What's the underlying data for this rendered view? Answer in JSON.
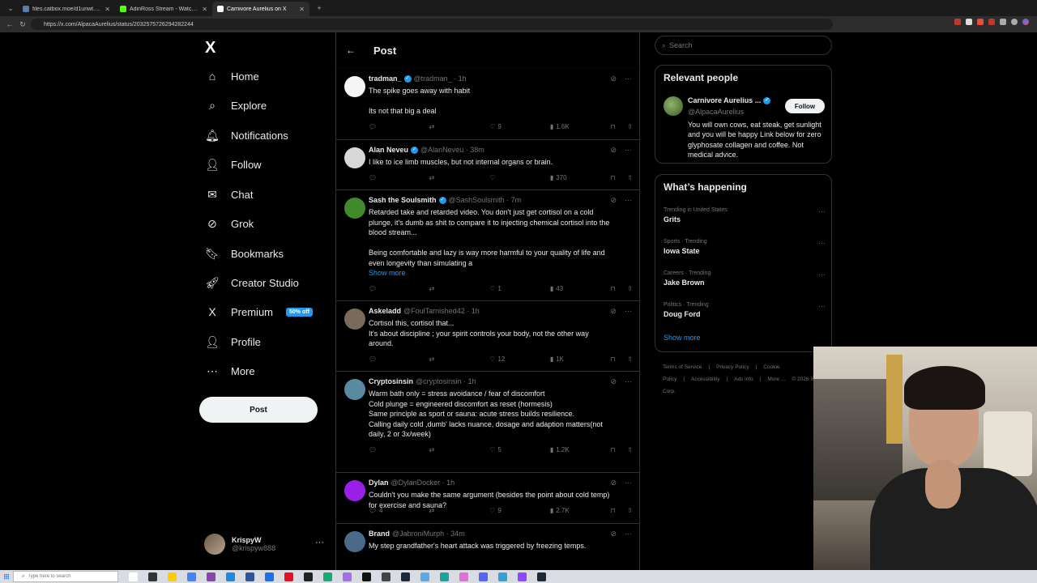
{
  "browser": {
    "tabs": [
      {
        "label": "files.catbox.moe/d1unwt.mp4",
        "color": "#5b7fa8",
        "active": false
      },
      {
        "label": "AdinRoss Stream - Watch Live on Kick",
        "color": "#53fc18",
        "active": false
      },
      {
        "label": "Carnivore Aurelius on X",
        "color": "#ffffff",
        "active": true
      }
    ],
    "url": "https://x.com/AlpacaAurelius/status/2032575726294282244"
  },
  "sidebar": {
    "logo": "X",
    "items": [
      {
        "label": "Home",
        "icon": "home-icon",
        "glyph": "⌂"
      },
      {
        "label": "Explore",
        "icon": "search-icon",
        "glyph": "⌕"
      },
      {
        "label": "Notifications",
        "icon": "bell-icon",
        "glyph": "🔔︎"
      },
      {
        "label": "Follow",
        "icon": "person-plus-icon",
        "glyph": "👤︎"
      },
      {
        "label": "Chat",
        "icon": "mail-icon",
        "glyph": "✉"
      },
      {
        "label": "Grok",
        "icon": "grok-icon",
        "glyph": "⊘"
      },
      {
        "label": "Bookmarks",
        "icon": "bookmark-icon",
        "glyph": "🔖︎"
      },
      {
        "label": "Creator Studio",
        "icon": "rocket-icon",
        "glyph": "🚀︎"
      },
      {
        "label": "Premium",
        "icon": "x-icon",
        "glyph": "X",
        "badge": "50% off"
      },
      {
        "label": "Profile",
        "icon": "profile-icon",
        "glyph": "👤︎"
      },
      {
        "label": "More",
        "icon": "more-circle-icon",
        "glyph": "⋯"
      }
    ],
    "post_label": "Post",
    "account": {
      "name": "KrispyW",
      "handle": "@krispyw888"
    }
  },
  "header": {
    "title": "Post"
  },
  "tweets": [
    {
      "name": "tradman_",
      "handle": "@tradman_ · 1h",
      "verified": true,
      "avatar_color": "#f5f5f5",
      "lines": [
        "The spike goes away with habit",
        "",
        "Its not that big a deal"
      ],
      "replies": "",
      "retweets": "",
      "likes": "9",
      "views": "1.6K"
    },
    {
      "name": "Alan Neveu",
      "handle": "@AlanNeveu · 38m",
      "verified": true,
      "avatar_color": "#d8d8d8",
      "lines": [
        "I like to ice limb muscles, but not internal organs or brain."
      ],
      "replies": "",
      "retweets": "",
      "likes": "",
      "views": "370"
    },
    {
      "name": "Sash the Soulsmith",
      "handle": "@SashSoulsmith · 7m",
      "verified": true,
      "avatar_color": "#3f8a2a",
      "lines": [
        "Retarded take and retarded video. You don't just get cortisol on a cold",
        "plunge, it's dumb as shit to compare it to injecting chemical cortisol into the",
        "blood stream...",
        "",
        "Being comfortable and lazy is way more harmful to your quality of life and",
        "even longevity than simulating a"
      ],
      "show_more": "Show more",
      "replies": "",
      "retweets": "",
      "likes": "1",
      "views": "43"
    },
    {
      "name": "Askeladd",
      "handle": "@FoulTarnished42 · 1h",
      "verified": false,
      "avatar_color": "#7a6a5a",
      "lines": [
        "Cortisol this, cortisol that...",
        "It's about discipline ; your spirit controls your body, not the other way",
        "around."
      ],
      "replies": "",
      "retweets": "",
      "likes": "12",
      "views": "1K"
    },
    {
      "name": "Cryptosinsin",
      "handle": "@cryptosinsin · 1h",
      "verified": false,
      "avatar_color": "#5a8aa0",
      "lines": [
        "Warm bath only = stress avoidance / fear of discomfort",
        "Cold plunge = engineered discomfort as reset (hormesis)",
        "Same principle as sport or sauna: acute stress builds resilience.",
        "Calling daily cold ,dumb' lacks nuance, dosage and adaption matters(not",
        "daily, 2 or 3x/week)"
      ],
      "replies": "",
      "retweets": "",
      "likes": "5",
      "views": "1.2K"
    },
    {
      "name": "Dylan",
      "handle": "@DylanDocker · 1h",
      "verified": false,
      "avatar_color": "#9b1fe8",
      "lines": [
        "Couldn't you make the same argument (besides the point about cold temp)",
        "for exercise and sauna?"
      ],
      "replies": "4",
      "retweets": "",
      "likes": "9",
      "views": "2.7K"
    },
    {
      "name": "Brand",
      "handle": "@JabroniMurph · 34m",
      "verified": false,
      "avatar_color": "#4a6a8a",
      "lines": [
        "My step grandfather's heart attack was triggered by freezing temps."
      ],
      "replies": "",
      "retweets": "",
      "likes": "",
      "views": ""
    }
  ],
  "right": {
    "search_placeholder": "Search",
    "relevant": {
      "title": "Relevant people",
      "name": "Carnivore Aurelius ...",
      "handle": "@AlpacaAurelius",
      "follow_label": "Follow",
      "bio": "You will own cows, eat steak, get sunlight and you will be happy Link below for zero glyphosate collagen and coffee. Not medical advice."
    },
    "happening": {
      "title": "What’s happening",
      "trends": [
        {
          "context": "Trending in United States",
          "name": "Grits"
        },
        {
          "context": "Sports · Trending",
          "name": "Iowa State"
        },
        {
          "context": "Careers · Trending",
          "name": "Jake Brown"
        },
        {
          "context": "Politics · Trending",
          "name": "Doug Ford"
        }
      ],
      "show_more": "Show more"
    },
    "footer": [
      "Terms of Service",
      "|",
      "Privacy Policy",
      "|",
      "Cookie Policy",
      "|",
      "Accessibility",
      "|",
      "Ads info",
      "|",
      "More ...",
      "© 2026 X Corp."
    ]
  },
  "taskbar": {
    "search_placeholder": "Type here to search"
  }
}
